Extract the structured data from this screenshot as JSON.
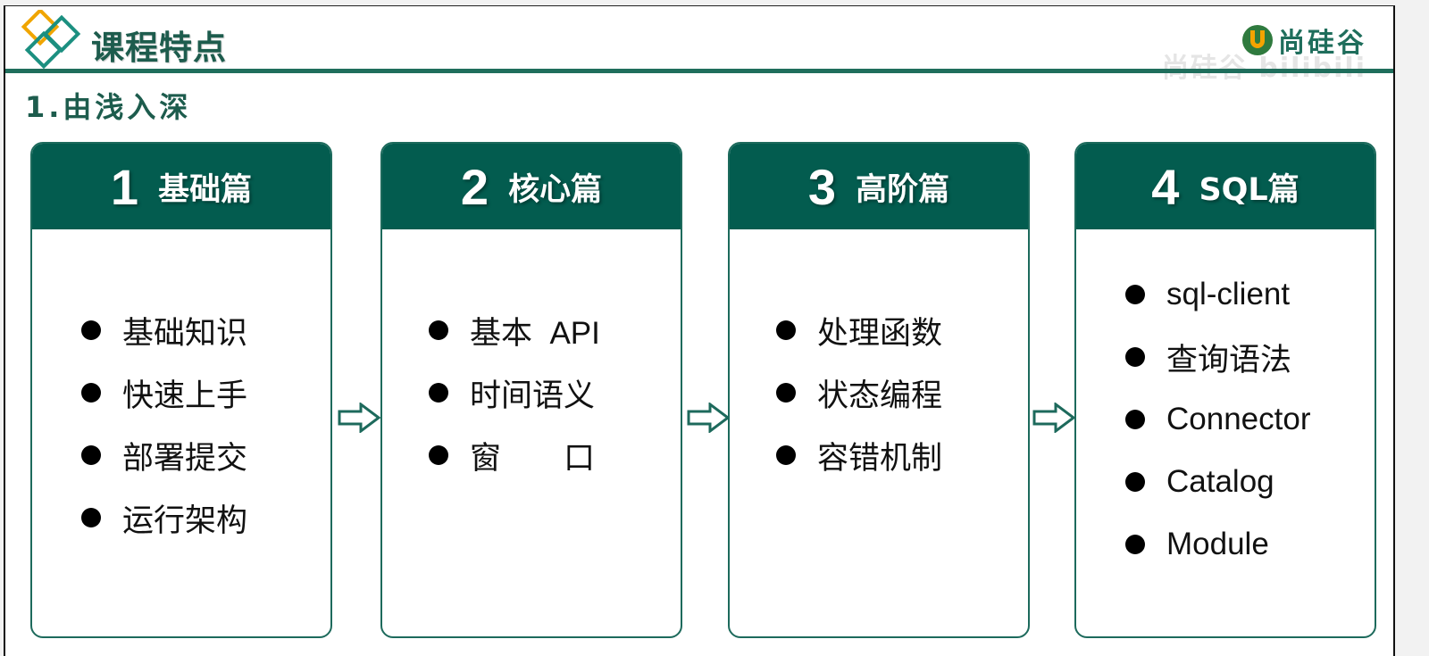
{
  "header": {
    "title": "课程特点",
    "brand": "尚硅谷",
    "watermark": "尚硅谷 bilibili"
  },
  "section": {
    "title": "1.由浅入深"
  },
  "colors": {
    "primary": "#035c4f",
    "accent_orange": "#f0a500",
    "accent_teal": "#1b8f80"
  },
  "cards": [
    {
      "num": "1",
      "name": "基础篇",
      "items": [
        "基础知识",
        "快速上手",
        "部署提交",
        "运行架构"
      ]
    },
    {
      "num": "2",
      "name": "核心篇",
      "items": [
        "基本  API",
        "时间语义",
        "窗　　口"
      ]
    },
    {
      "num": "3",
      "name": "高阶篇",
      "items": [
        "处理函数",
        "状态编程",
        "容错机制"
      ]
    },
    {
      "num": "4",
      "name": "SQL篇",
      "items": [
        "sql-client",
        "查询语法",
        "Connector",
        "Catalog",
        "Module"
      ]
    }
  ],
  "icons": {
    "arrow": "right-arrow-outline-icon",
    "logo": "diamonds-logo-icon"
  }
}
